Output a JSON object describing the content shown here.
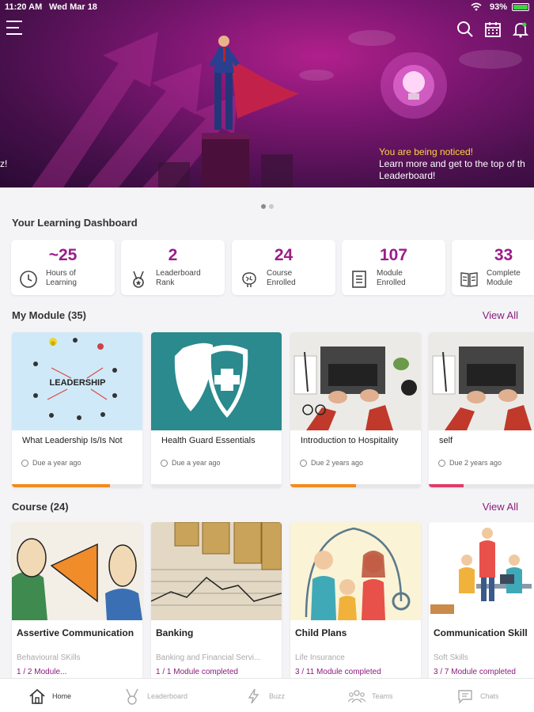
{
  "status_bar": {
    "time": "11:20 AM",
    "date": "Wed Mar 18",
    "battery": "93%"
  },
  "hero": {
    "left_fragment": "z!",
    "notice_highlight": "You are being noticed!",
    "notice_line1": "Learn more and get to the top of th",
    "notice_line2": "Leaderboard!"
  },
  "dashboard": {
    "title": "Your Learning Dashboard",
    "stats": [
      {
        "value": "~25",
        "label1": "Hours of",
        "label2": "Learning",
        "icon": "clock-icon"
      },
      {
        "value": "2",
        "label1": "Leaderboard",
        "label2": "Rank",
        "icon": "medal-icon"
      },
      {
        "value": "24",
        "label1": "Course",
        "label2": "Enrolled",
        "icon": "brain-icon"
      },
      {
        "value": "107",
        "label1": "Module",
        "label2": "Enrolled",
        "icon": "document-icon"
      },
      {
        "value": "33",
        "label1": "Complete",
        "label2": "Module",
        "icon": "book-icon"
      }
    ]
  },
  "modules": {
    "title": "My Module (35)",
    "view_all": "View All",
    "items": [
      {
        "title": "What Leadership Is/Is Not",
        "due": "Due a year ago",
        "progress": 0.75,
        "progress_color": "#f28a1c"
      },
      {
        "title": "Health Guard Essentials",
        "due": "Due a year ago",
        "progress": 0,
        "progress_color": "#f28a1c"
      },
      {
        "title": "Introduction to Hospitality",
        "due": "Due 2 years ago",
        "progress": 0.5,
        "progress_color": "#f28a1c"
      },
      {
        "title": "self",
        "due": "Due 2 years ago",
        "progress": 0.33,
        "progress_color": "#e23a6a"
      }
    ]
  },
  "courses": {
    "title": "Course (24)",
    "view_all": "View All",
    "items": [
      {
        "title": "Assertive Communication",
        "category": "Behavioural SKills",
        "progress": "1 / 2 Module..."
      },
      {
        "title": "Banking",
        "category": "Banking and Financial Servi...",
        "progress": "1 / 1 Module completed"
      },
      {
        "title": "Child Plans",
        "category": "Life Insurance",
        "progress": "3 / 11 Module completed"
      },
      {
        "title": "Communication Skill",
        "category": "Soft Skills",
        "progress": "3 / 7 Module completed"
      }
    ]
  },
  "nav": {
    "home": "Home",
    "leaderboard": "Leaderboard",
    "buzz": "Buzz",
    "teams": "Teams",
    "chats": "Chats"
  },
  "colors": {
    "accent": "#9c1b8a",
    "link": "#8a1b7c",
    "module_progress": "#f28a1c"
  }
}
